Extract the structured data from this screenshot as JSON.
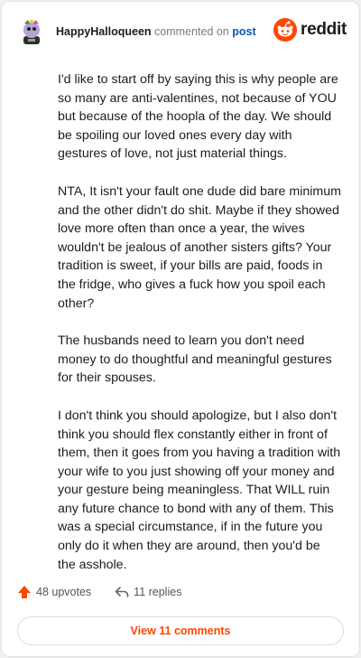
{
  "header": {
    "username": "HappyHalloqueen",
    "action_text": "commented on",
    "target_text": "post",
    "brand": "reddit"
  },
  "comment": {
    "paragraphs": [
      "I'd like to start off by saying this is why people are so many are anti-valentines, not because of YOU but because of the hoopla of the day. We should be spoiling our loved ones every day with gestures of love, not just material things.",
      "NTA, It isn't your fault one dude did bare minimum and the other didn't do shit. Maybe if they showed love more often than once a year, the wives wouldn't be jealous of another sisters gifts? Your tradition is sweet, if your bills are paid, foods in the fridge, who gives a fuck how you spoil each other?",
      "The husbands need to learn you don't need money to do thoughtful and meaningful gestures for their spouses.",
      "I don't think you should apologize, but I also don't think you should flex constantly either in front of them, then it goes from you having a tradition with your wife to you just showing off your money and your gesture being meaningless. That WILL ruin any future chance to bond with any of them. This was a special circumstance, if in the future you only do it when they are around, then you'd be the asshole."
    ]
  },
  "footer": {
    "upvotes": "48 upvotes",
    "replies": "11 replies",
    "view_comments": "View 11 comments"
  },
  "colors": {
    "brand_orange": "#ff4500",
    "link_blue": "#0a58ad",
    "text": "#1c1c1c"
  },
  "icons": {
    "avatar": "user-avatar",
    "logo": "reddit-snoo-icon",
    "upvote": "upvote-arrow-icon",
    "reply": "reply-arrow-icon"
  }
}
